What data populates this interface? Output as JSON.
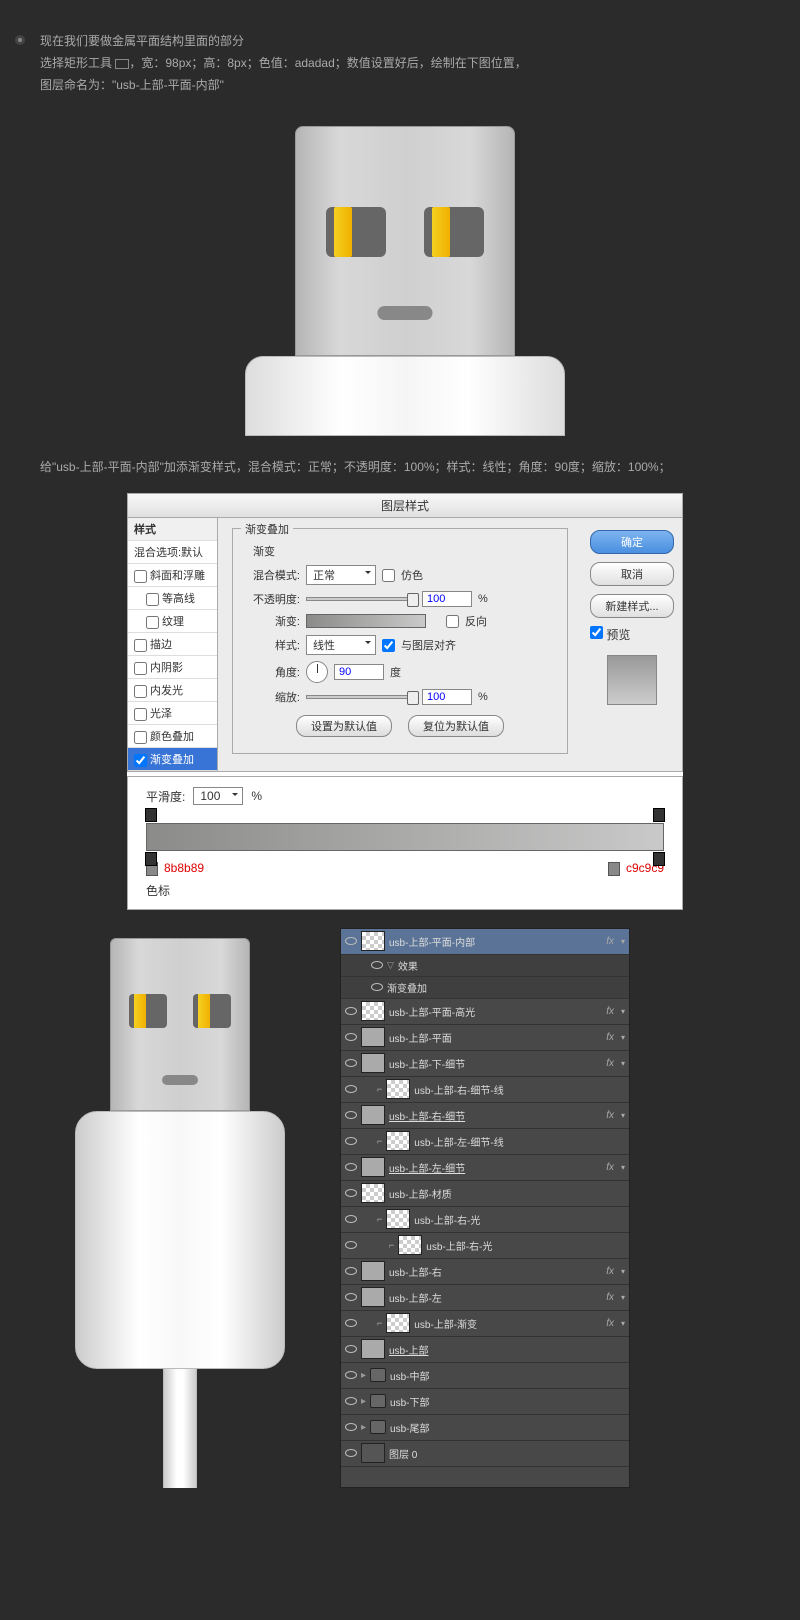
{
  "intro": {
    "p1": "现在我们要做金属平面结构里面的部分",
    "p2a": "选择矩形工具 ",
    "p2b": "，宽：98px；高：8px；色值：adadad；数值设置好后，绘制在下图位置，",
    "p3": "图层命名为：\"usb-上部-平面-内部\""
  },
  "desc2": "给\"usb-上部-平面-内部\"加添渐变样式，混合模式：正常；不透明度：100%；样式：线性；角度：90度；缩放：100%；",
  "panel": {
    "title": "图层样式",
    "styles_hdr": "样式",
    "blend_opts": "混合选项:默认",
    "items": [
      "斜面和浮雕",
      "等高线",
      "纹理",
      "描边",
      "内阴影",
      "内发光",
      "光泽",
      "颜色叠加",
      "渐变叠加"
    ],
    "legend": "渐变叠加",
    "sub": "渐变",
    "blend_mode_l": "混合模式:",
    "blend_mode_v": "正常",
    "dither": "仿色",
    "opacity_l": "不透明度:",
    "opacity_v": "100",
    "pct": "%",
    "gradient_l": "渐变:",
    "reverse": "反向",
    "style_l": "样式:",
    "style_v": "线性",
    "align": "与图层对齐",
    "angle_l": "角度:",
    "angle_v": "90",
    "deg": "度",
    "scale_l": "缩放:",
    "scale_v": "100",
    "btn_default": "设置为默认值",
    "btn_reset": "复位为默认值",
    "btn_ok": "确定",
    "btn_cancel": "取消",
    "btn_new": "新建样式...",
    "preview": "预览"
  },
  "grad_ed": {
    "smooth_l": "平滑度:",
    "smooth_v": "100",
    "pct": "%",
    "left_color": "8b8b89",
    "right_color": "c9c9c9",
    "stops": "色标"
  },
  "layers": [
    {
      "name": "usb-上部-平面-内部",
      "fx": true,
      "sel": true,
      "thumb": "chk"
    },
    {
      "name": "效果",
      "sub": true,
      "arrow": true
    },
    {
      "name": "渐变叠加",
      "sub": true
    },
    {
      "name": "usb-上部-平面-高光",
      "fx": true,
      "thumb": "chk"
    },
    {
      "name": "usb-上部-平面",
      "fx": true,
      "thumb": "norm"
    },
    {
      "name": "usb-上部-下-细节",
      "fx": true,
      "thumb": "norm"
    },
    {
      "name": "usb-上部-右-细节-线",
      "thumb": "chk",
      "indent": 1,
      "link": true
    },
    {
      "name": "usb-上部-右-细节",
      "fx": true,
      "thumb": "norm",
      "u": true
    },
    {
      "name": "usb-上部-左-细节-线",
      "thumb": "chk",
      "indent": 1,
      "link": true
    },
    {
      "name": "usb-上部-左-细节",
      "fx": true,
      "thumb": "norm",
      "u": true
    },
    {
      "name": "usb-上部-材质",
      "thumb": "chk"
    },
    {
      "name": "usb-上部-右-光",
      "thumb": "chk",
      "indent": 1,
      "link": true
    },
    {
      "name": "usb-上部-右-光",
      "thumb": "chk",
      "indent": 2,
      "link": true
    },
    {
      "name": "usb-上部-右",
      "fx": true,
      "thumb": "norm"
    },
    {
      "name": "usb-上部-左",
      "fx": true,
      "thumb": "norm"
    },
    {
      "name": "usb-上部-渐变",
      "fx": true,
      "thumb": "chk",
      "indent": 1,
      "link": true
    },
    {
      "name": "usb-上部",
      "thumb": "norm",
      "u": true
    },
    {
      "name": "usb-中部",
      "folder": true
    },
    {
      "name": "usb-下部",
      "folder": true
    },
    {
      "name": "usb-尾部",
      "folder": true
    },
    {
      "name": "图层 0",
      "thumb": "dark"
    }
  ]
}
